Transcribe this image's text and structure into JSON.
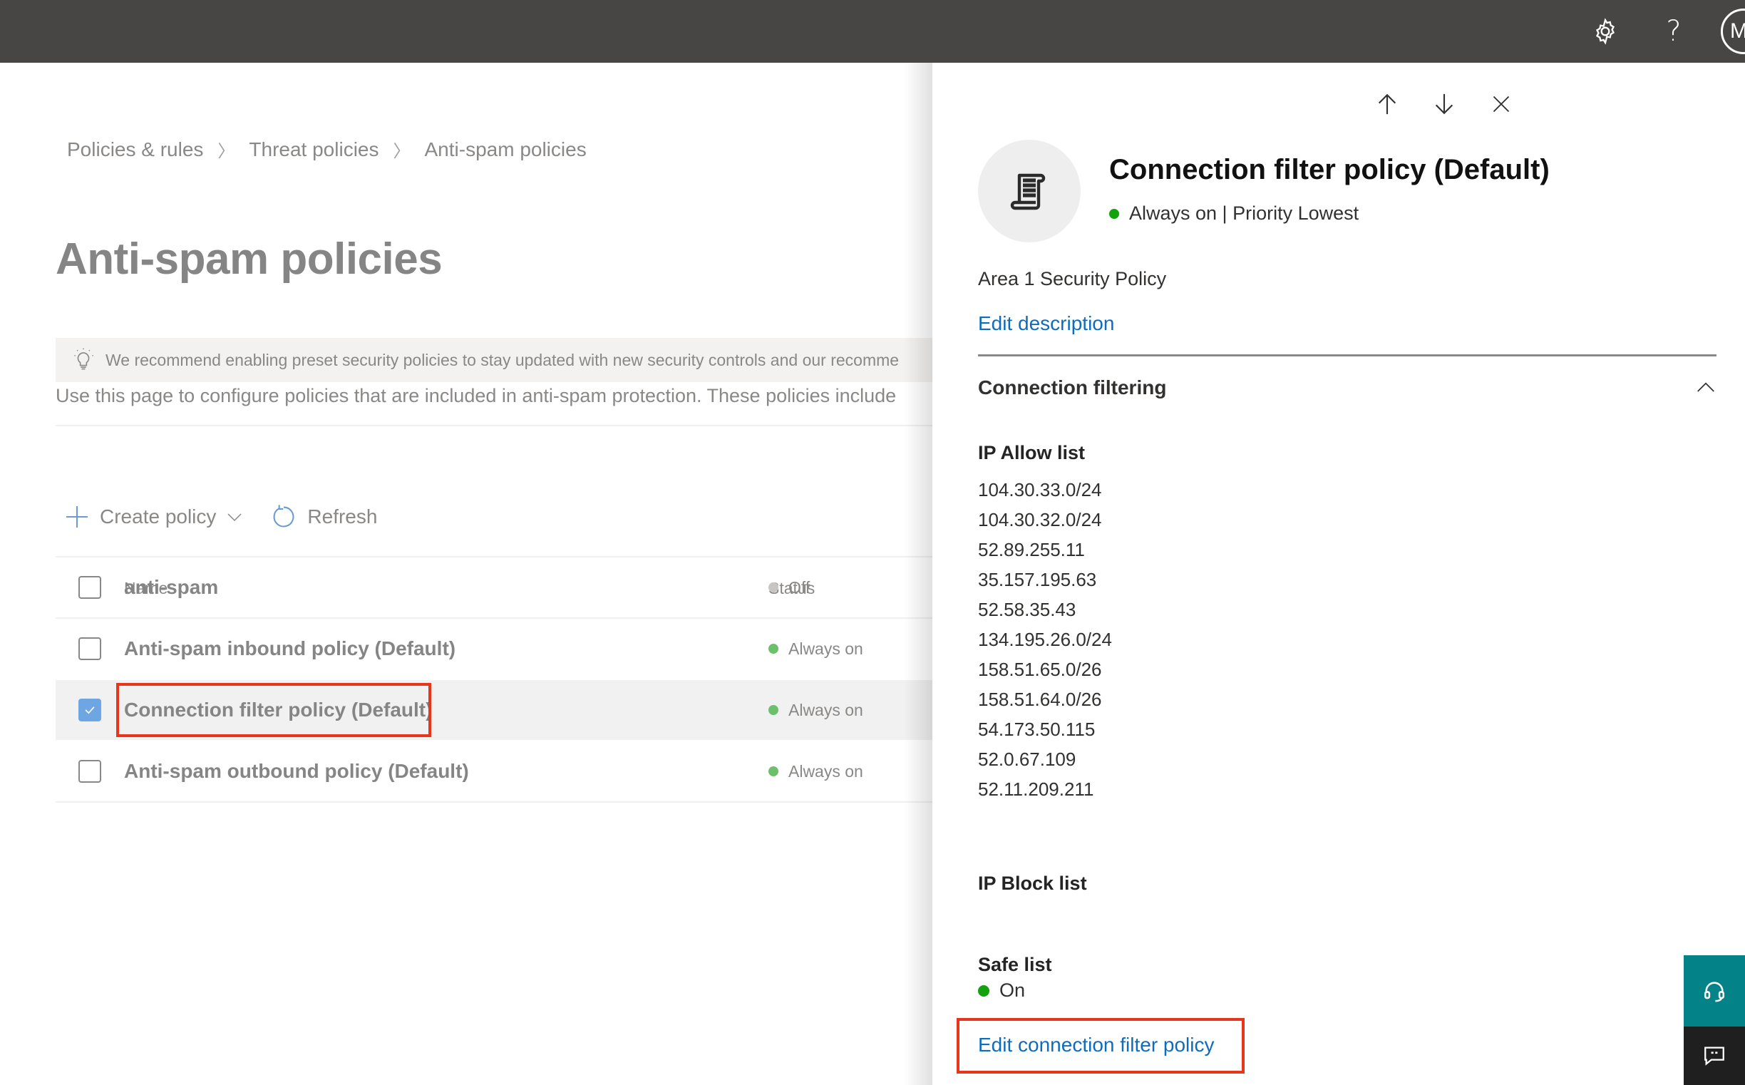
{
  "topbar": {
    "icons": [
      "gear-icon",
      "help-icon"
    ],
    "avatar_initial": "M"
  },
  "breadcrumb": [
    "Policies & rules",
    "Threat policies",
    "Anti-spam policies"
  ],
  "page": {
    "title": "Anti-spam policies",
    "banner": "We recommend enabling preset security policies to stay updated with new security controls and our recomme",
    "intro": "Use this page to configure policies that are included in anti-spam protection. These policies include"
  },
  "toolbar": {
    "create_label": "Create policy",
    "refresh_label": "Refresh"
  },
  "table": {
    "columns": [
      "Name",
      "Status"
    ],
    "rows": [
      {
        "name": "anti-spam",
        "status": "Off",
        "checked": false,
        "status_color": "#c8c6c4"
      },
      {
        "name": "Anti-spam inbound policy (Default)",
        "status": "Always on",
        "checked": false,
        "status_color": "#6cc06c"
      },
      {
        "name": "Connection filter policy (Default)",
        "status": "Always on",
        "checked": true,
        "status_color": "#6cc06c"
      },
      {
        "name": "Anti-spam outbound policy (Default)",
        "status": "Always on",
        "checked": false,
        "status_color": "#6cc06c"
      }
    ]
  },
  "panel": {
    "title": "Connection filter policy (Default)",
    "status": "Always on | Priority Lowest",
    "description": "Area 1 Security Policy",
    "edit_description_label": "Edit description",
    "section_label": "Connection filtering",
    "ip_allow_label": "IP Allow list",
    "ip_allow_list": [
      "104.30.33.0/24",
      "104.30.32.0/24",
      "52.89.255.11",
      "35.157.195.63",
      "52.58.35.43",
      "134.195.26.0/24",
      "158.51.65.0/26",
      "158.51.64.0/26",
      "54.173.50.115",
      "52.0.67.109",
      "52.11.209.211"
    ],
    "ip_block_label": "IP Block list",
    "safe_list_label": "Safe list",
    "safe_list_value": "On",
    "edit_policy_label": "Edit connection filter policy"
  },
  "colors": {
    "topbar": "#484644",
    "link": "#0f6cbd",
    "status_on": "#13a10e",
    "highlight": "#e8361c",
    "help_teal": "#038387"
  }
}
